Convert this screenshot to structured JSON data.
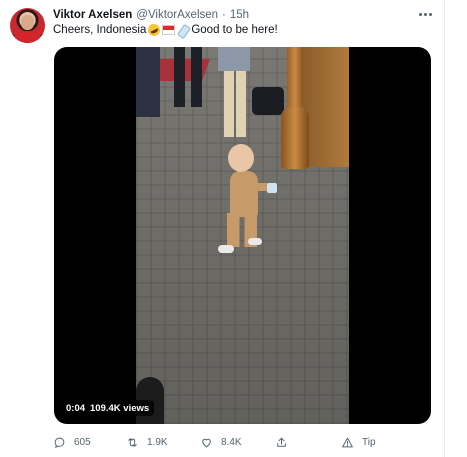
{
  "tweet": {
    "author_name": "Viktor Axelsen",
    "author_handle": "@ViktorAxelsen",
    "separator": "·",
    "time": "15h",
    "text_before": "Cheers, Indonesia",
    "text_after": "Good to be here!",
    "emojis": [
      "rolling-on-floor-laughing",
      "indonesia-flag",
      "baby-bottle"
    ]
  },
  "video": {
    "duration": "0:04",
    "views": "109.4K views"
  },
  "actions": {
    "reply_count": "605",
    "retweet_count": "1.9K",
    "like_count": "8.4K",
    "tip_label": "Tip"
  },
  "icons": [
    "reply-icon",
    "retweet-icon",
    "like-icon",
    "share-icon",
    "tip-icon",
    "more-icon"
  ],
  "colors": {
    "text": "#0f1419",
    "secondary": "#536471",
    "border": "#e6ecf0",
    "background": "#ffffff"
  }
}
